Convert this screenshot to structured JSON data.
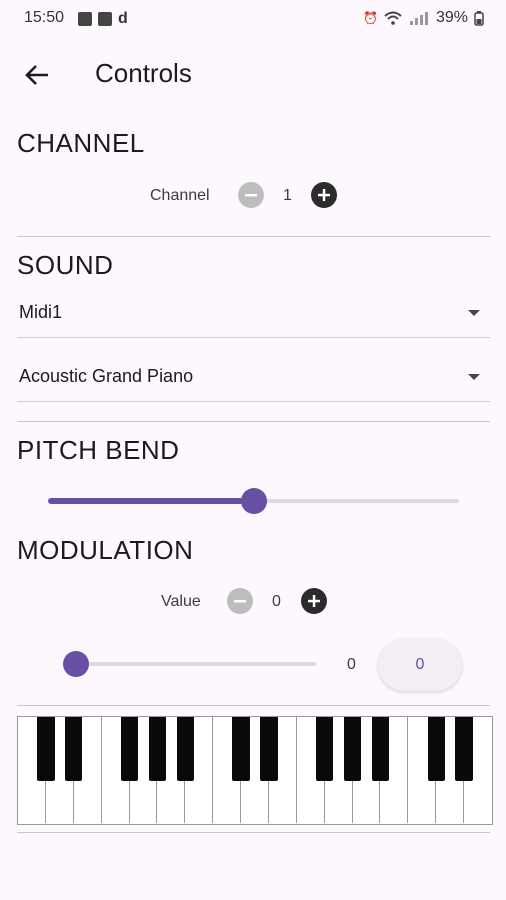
{
  "status": {
    "time": "15:50",
    "left_icons": [
      "image-icon",
      "app-icon"
    ],
    "left_letter": "d",
    "battery": "39%"
  },
  "appbar": {
    "title": "Controls"
  },
  "channel": {
    "title": "CHANNEL",
    "label": "Channel",
    "value": "1"
  },
  "sound": {
    "title": "SOUND",
    "device": "Midi1",
    "instrument": "Acoustic Grand Piano"
  },
  "pitch_bend": {
    "title": "PITCH BEND",
    "level": 0.5
  },
  "modulation": {
    "title": "MODULATION",
    "label": "Value",
    "stepper_value": "0",
    "slider_value": "0",
    "field_value": "0",
    "level": 0.0
  },
  "colors": {
    "accent": "#6750a4",
    "background": "#fdf8fd"
  }
}
